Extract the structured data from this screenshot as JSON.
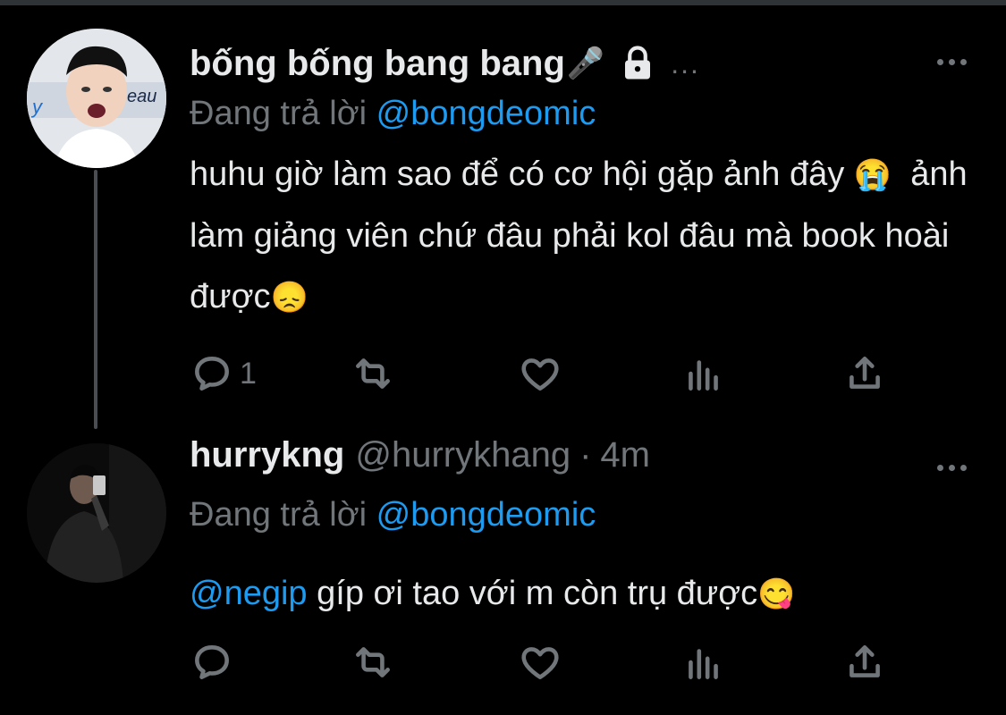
{
  "thread": [
    {
      "author": {
        "display_name": "bống bống bang bang",
        "name_emoji": "🎤",
        "locked": true,
        "ellipsis": "..."
      },
      "reply_prefix": "Đang trả lời",
      "reply_to": "@bongdeomic",
      "text_before_emoji": "huhu giờ làm sao để có cơ hội gặp ảnh đây",
      "emoji_1": "😭",
      "text_after_emoji": "ảnh làm giảng viên chứ đâu phải kol đâu mà book hoài được",
      "emoji_2": "😞",
      "actions": {
        "reply_count": "1"
      }
    },
    {
      "author": {
        "display_name": "hurrykng",
        "handle": "@hurrykhang",
        "separator": "·",
        "time": "4m"
      },
      "reply_prefix": "Đang trả lời",
      "reply_to": "@bongdeomic",
      "mention": "@negip",
      "text": "gíp ơi tao với m còn trụ được",
      "emoji": "😋"
    }
  ],
  "icons": {
    "reply": "reply-icon",
    "retweet": "retweet-icon",
    "like": "like-icon",
    "analytics": "analytics-icon",
    "share": "share-icon",
    "more": "more-icon",
    "lock": "lock-icon"
  },
  "colors": {
    "background": "#000000",
    "text": "#e7e9ea",
    "muted": "#71767b",
    "link": "#1d9bf0"
  }
}
